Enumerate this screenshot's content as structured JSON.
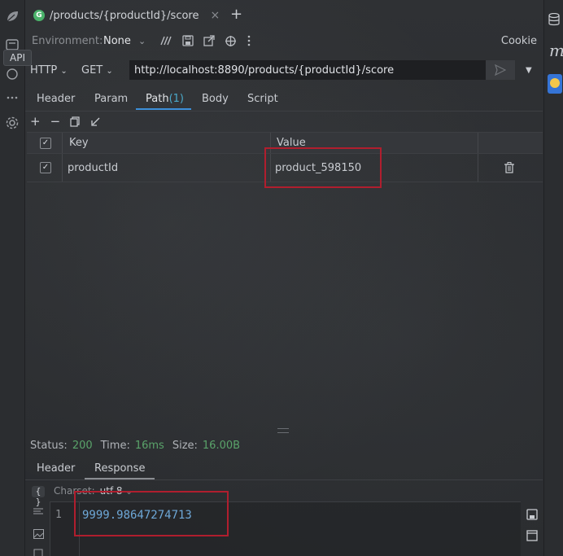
{
  "left_strip": {
    "icons": [
      "leaf-icon",
      "api-icon",
      "more-icon",
      "settings-icon"
    ],
    "tooltip": "API"
  },
  "tab": {
    "badge": "G",
    "title": "/products/{productId}/score",
    "close": "×",
    "add": "+"
  },
  "env": {
    "label": "Environment:",
    "value": "None",
    "cookie_label": "Cookie"
  },
  "request": {
    "protocol": "HTTP",
    "method": "GET",
    "url": "http://localhost:8890/products/{productId}/score"
  },
  "req_tabs": {
    "header": "Header",
    "param": "Param",
    "path": "Path",
    "path_count": "(1)",
    "body": "Body",
    "script": "Script"
  },
  "grid": {
    "col_key": "Key",
    "col_value": "Value",
    "rows": [
      {
        "key": "productId",
        "value": "product_598150",
        "checked": true
      }
    ]
  },
  "status": {
    "status_label": "Status:",
    "status_value": "200",
    "time_label": "Time:",
    "time_value": "16ms",
    "size_label": "Size:",
    "size_value": "16.00B"
  },
  "resp_tabs": {
    "header": "Header",
    "response": "Response"
  },
  "response": {
    "charset_label": "Charset:",
    "charset_value": "utf-8",
    "line_number": "1",
    "body": "9999.98647274713"
  },
  "colors": {
    "accent_blue": "#3d8fd9",
    "status_green": "#5aa36a",
    "highlight_red": "#b01e2e",
    "code_blue": "#6ea8d8"
  }
}
